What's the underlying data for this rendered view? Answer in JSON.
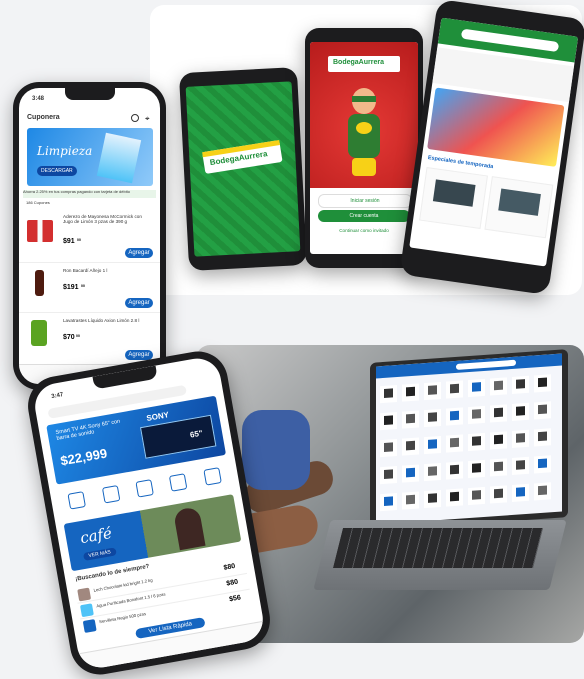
{
  "phone1": {
    "time": "3:48",
    "header": "Cuponera",
    "banner_title": "Limpieza",
    "banner_button": "DESCARGAR",
    "ahorro": "Ahorra 2.25% en tus compras pagando con tarjeta de débito",
    "count": "186 Cupones",
    "items": [
      {
        "name": "Aderezo de Mayonesa McCormick con Jugo de Limón 3 pzas de 390 g",
        "price": "$91",
        "cents": "00"
      },
      {
        "name": "Ron Bacardí Añejo 1 l",
        "price": "$191",
        "cents": "00"
      },
      {
        "name": "Lavatrastes Líquido Axion Limón 2.8 l",
        "price": "$70",
        "cents": "00"
      }
    ],
    "add_label": "Agregar"
  },
  "phone2": {
    "logo": "BodegaAurrera"
  },
  "phone3": {
    "logo": "BodegaAurrera",
    "login": "Iniciar sesión",
    "create": "Crear cuenta",
    "guest": "Continuar como invitado"
  },
  "phone4": {
    "section": "Especiales de temporada"
  },
  "phone5": {
    "time": "3:47",
    "tv_title": "Smart TV 4K Sony 65\" con barra de sonido",
    "tv_brand": "SONY",
    "tv_size": "65\"",
    "tv_price": "$22,999",
    "cafe_title": "café",
    "cafe_button": "VER MÁS",
    "section": "¡Buscando lo de siempre?",
    "rows": [
      {
        "name": "Lech Chocolate kid bright 1.2 kg",
        "price": "$80"
      },
      {
        "name": "Agua Purificada Bonafont 1.5 l 6 pzas",
        "price": "$80"
      },
      {
        "name": "Servilleta Regio 500 pzas",
        "price": "$56"
      }
    ],
    "cart_label": "Ver Lista Rápida"
  },
  "colors": {
    "blue": "#1565c0",
    "green": "#1f8f3a",
    "red": "#d0201f",
    "yellow": "#f7d117"
  }
}
